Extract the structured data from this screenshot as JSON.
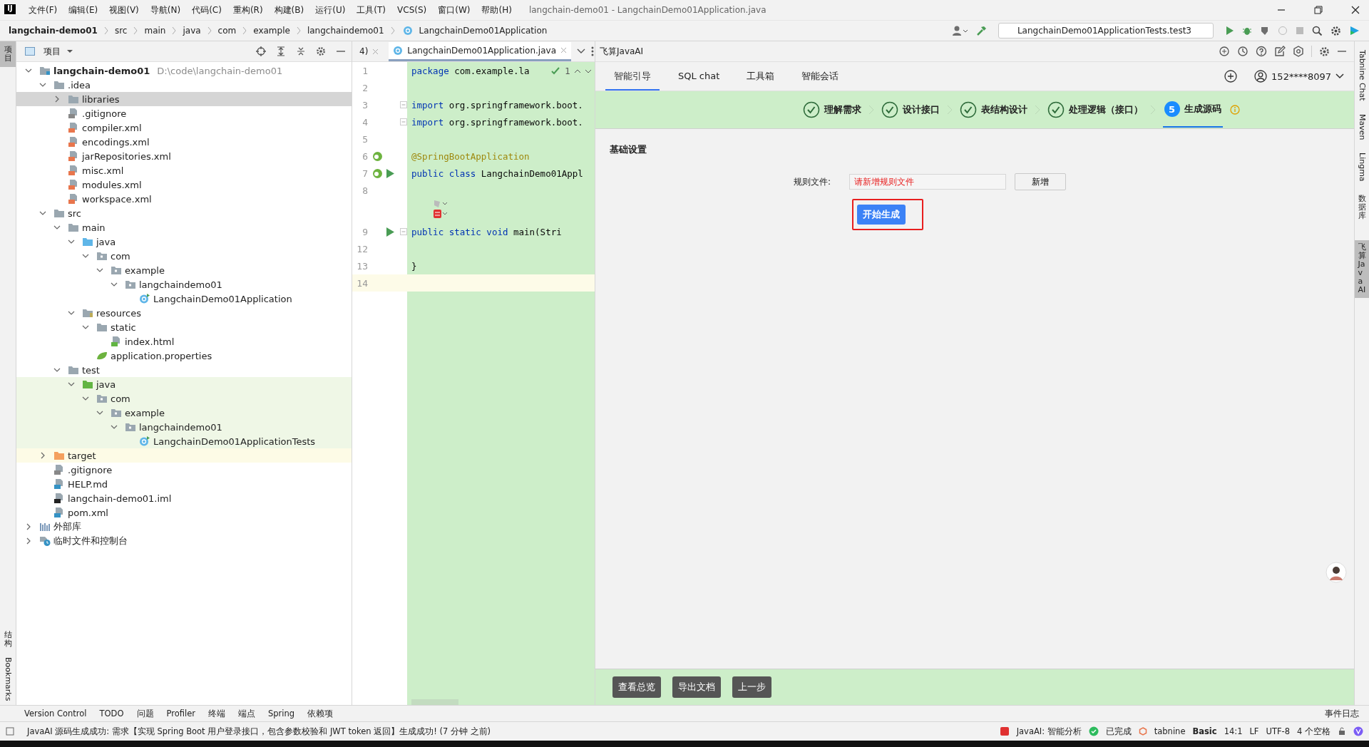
{
  "window": {
    "logo": "IJ",
    "title": "langchain-demo01 - LangchainDemo01Application.java"
  },
  "menu": [
    "文件(F)",
    "编辑(E)",
    "视图(V)",
    "导航(N)",
    "代码(C)",
    "重构(R)",
    "构建(B)",
    "运行(U)",
    "工具(T)",
    "VCS(S)",
    "窗口(W)",
    "帮助(H)"
  ],
  "breadcrumbs": [
    {
      "label": "langchain-demo01",
      "kind": "project"
    },
    {
      "label": "src",
      "kind": "dir"
    },
    {
      "label": "main",
      "kind": "dir"
    },
    {
      "label": "java",
      "kind": "dir"
    },
    {
      "label": "com",
      "kind": "dir"
    },
    {
      "label": "example",
      "kind": "dir"
    },
    {
      "label": "langchaindemo01",
      "kind": "dir"
    },
    {
      "label": "LangchainDemo01Application",
      "kind": "class"
    }
  ],
  "run_config": "LangchainDemo01ApplicationTests.test3",
  "left_strip": [
    {
      "label": "项目",
      "kind": "cjk",
      "selected": true
    },
    {
      "label": "结构",
      "kind": "cjk",
      "selected": false
    },
    {
      "label": "Bookmarks",
      "kind": "latin",
      "selected": false
    }
  ],
  "right_strip": [
    {
      "label": "Tabnine Chat",
      "kind": "latin",
      "selected": false
    },
    {
      "label": "Maven",
      "kind": "latin",
      "selected": false
    },
    {
      "label": "Lingma",
      "kind": "latin",
      "selected": false
    },
    {
      "label": "数据库",
      "kind": "cjk",
      "selected": false
    },
    {
      "label": "飞算JavaAI",
      "kind": "cjk",
      "selected": true
    }
  ],
  "project": {
    "title": "项目",
    "tree": [
      {
        "name": "langchain-demo01",
        "kind": "module",
        "path": "D:\\code\\langchain-demo01",
        "expanded": true,
        "selected": false,
        "children": [
          {
            "name": ".idea",
            "kind": "folder",
            "expanded": true,
            "selected": false,
            "children": [
              {
                "name": "libraries",
                "kind": "folder",
                "expanded": false,
                "selected": true
              },
              {
                "name": ".gitignore",
                "kind": "ignore",
                "selected": false
              },
              {
                "name": "compiler.xml",
                "kind": "xml",
                "selected": false
              },
              {
                "name": "encodings.xml",
                "kind": "xml",
                "selected": false
              },
              {
                "name": "jarRepositories.xml",
                "kind": "xml",
                "selected": false
              },
              {
                "name": "misc.xml",
                "kind": "xml",
                "selected": false
              },
              {
                "name": "modules.xml",
                "kind": "xml",
                "selected": false
              },
              {
                "name": "workspace.xml",
                "kind": "xml",
                "selected": false
              }
            ]
          },
          {
            "name": "src",
            "kind": "folder",
            "expanded": true,
            "selected": false,
            "children": [
              {
                "name": "main",
                "kind": "folder",
                "expanded": true,
                "selected": false,
                "children": [
                  {
                    "name": "java",
                    "kind": "source-folder",
                    "expanded": true,
                    "selected": false,
                    "children": [
                      {
                        "name": "com",
                        "kind": "package",
                        "expanded": true,
                        "selected": false,
                        "children": [
                          {
                            "name": "example",
                            "kind": "package",
                            "expanded": true,
                            "selected": false,
                            "children": [
                              {
                                "name": "langchaindemo01",
                                "kind": "package",
                                "expanded": true,
                                "selected": false,
                                "children": [
                                  {
                                    "name": "LangchainDemo01Application",
                                    "kind": "class",
                                    "selected": false
                                  }
                                ]
                              }
                            ]
                          }
                        ]
                      }
                    ]
                  },
                  {
                    "name": "resources",
                    "kind": "resources-folder",
                    "expanded": true,
                    "selected": false,
                    "children": [
                      {
                        "name": "static",
                        "kind": "folder",
                        "expanded": true,
                        "selected": false,
                        "children": [
                          {
                            "name": "index.html",
                            "kind": "html",
                            "selected": false
                          }
                        ]
                      },
                      {
                        "name": "application.properties",
                        "kind": "properties",
                        "selected": false
                      }
                    ]
                  }
                ]
              },
              {
                "name": "test",
                "kind": "folder",
                "expanded": true,
                "selected": false,
                "children": [
                  {
                    "name": "java",
                    "kind": "test-folder",
                    "test_root": true,
                    "expanded": true,
                    "selected": false,
                    "children": [
                      {
                        "name": "com",
                        "kind": "package",
                        "expanded": true,
                        "selected": false,
                        "children": [
                          {
                            "name": "example",
                            "kind": "package",
                            "expanded": true,
                            "selected": false,
                            "children": [
                              {
                                "name": "langchaindemo01",
                                "kind": "package",
                                "expanded": true,
                                "selected": false,
                                "children": [
                                  {
                                    "name": "LangchainDemo01ApplicationTests",
                                    "kind": "class",
                                    "selected": false
                                  }
                                ]
                              }
                            ]
                          }
                        ]
                      }
                    ]
                  }
                ]
              }
            ]
          },
          {
            "name": "target",
            "kind": "excluded-folder",
            "excluded": true,
            "expanded": false,
            "selected": false
          },
          {
            "name": ".gitignore",
            "kind": "ignore",
            "selected": false
          },
          {
            "name": "HELP.md",
            "kind": "md",
            "selected": false
          },
          {
            "name": "langchain-demo01.iml",
            "kind": "iml",
            "selected": false
          },
          {
            "name": "pom.xml",
            "kind": "pom",
            "selected": false
          }
        ]
      },
      {
        "name": "外部库",
        "kind": "libraries",
        "expanded": false,
        "selected": false
      },
      {
        "name": "临时文件和控制台",
        "kind": "scratches",
        "expanded": false,
        "selected": false
      }
    ]
  },
  "editor": {
    "tabs": [
      {
        "label": "4)",
        "selected": false
      },
      {
        "label": "LangchainDemo01Application.java",
        "selected": true
      }
    ],
    "inspection": {
      "count": "1"
    },
    "lines": [
      {
        "kind": "code",
        "number": "1",
        "current": false,
        "tokens": [
          {
            "kind": "keyword",
            "text": "package"
          },
          {
            "kind": "plain",
            "text": " com.example.la"
          }
        ]
      },
      {
        "kind": "code",
        "number": "2",
        "current": false
      },
      {
        "kind": "code",
        "number": "3",
        "current": false,
        "fold": true,
        "tokens": [
          {
            "kind": "keyword",
            "text": "import"
          },
          {
            "kind": "plain",
            "text": " org.springframework.boot."
          }
        ]
      },
      {
        "kind": "code",
        "number": "4",
        "current": false,
        "fold": true,
        "tokens": [
          {
            "kind": "keyword",
            "text": "import"
          },
          {
            "kind": "plain",
            "text": " org.springframework.boot."
          }
        ]
      },
      {
        "kind": "code",
        "number": "5",
        "current": false
      },
      {
        "kind": "code",
        "number": "6",
        "current": false,
        "bean": true,
        "tokens": [
          {
            "kind": "annotation",
            "text": "@SpringBootApplication"
          }
        ]
      },
      {
        "kind": "code",
        "number": "7",
        "current": false,
        "bean": true,
        "run": true,
        "tokens": [
          {
            "kind": "keyword",
            "text": "public class"
          },
          {
            "kind": "plain",
            "text": " LangchainDemo01Appl"
          }
        ]
      },
      {
        "kind": "code",
        "number": "8",
        "current": false
      },
      {
        "kind": "inlay"
      },
      {
        "kind": "code",
        "number": "9",
        "current": false,
        "run": true,
        "fold": true,
        "indented": true,
        "tokens": [
          {
            "kind": "keyword",
            "text": "public static void"
          },
          {
            "kind": "plain",
            "text": " main(Stri"
          }
        ]
      },
      {
        "kind": "code",
        "number": "12",
        "current": false
      },
      {
        "kind": "code",
        "number": "13",
        "current": false,
        "tokens": [
          {
            "kind": "plain",
            "text": "}"
          }
        ]
      },
      {
        "kind": "code",
        "number": "14",
        "current": true
      }
    ]
  },
  "ai_panel": {
    "title": "飞算JavaAI",
    "tabs": [
      {
        "label": "智能引导",
        "selected": true
      },
      {
        "label": "SQL chat",
        "selected": false
      },
      {
        "label": "工具箱",
        "selected": false
      },
      {
        "label": "智能会话",
        "selected": false
      }
    ],
    "account": "152****8097",
    "steps": [
      {
        "label": "理解需求",
        "done": true,
        "selected": false
      },
      {
        "label": "设计接口",
        "done": true,
        "selected": false
      },
      {
        "label": "表结构设计",
        "done": true,
        "selected": false
      },
      {
        "label": "处理逻辑（接口）",
        "done": true,
        "selected": false
      },
      {
        "label": "生成源码",
        "done": false,
        "selected": true,
        "number": "5"
      }
    ],
    "section": "基础设置",
    "field": {
      "label": "规则文件:",
      "placeholder": "请新增规则文件"
    },
    "add_button": "新增",
    "start_button": "开始生成",
    "footer_buttons": [
      "查看总览",
      "导出文档",
      "上一步"
    ]
  },
  "tool_windows": [
    "Version Control",
    "TODO",
    "问题",
    "Profiler",
    "终端",
    "端点",
    "Spring",
    "依赖项"
  ],
  "event_log": "事件日志",
  "status_bar": {
    "message": "JavaAI 源码生成成功: 需求【实现 Spring Boot 用户登录接口，包含参数校验和 JWT token 返回】生成成功! (7 分钟 之前)",
    "analysis": "JavaAI: 智能分析",
    "done": "已完成",
    "tabnine": "tabnine",
    "tabnine_plan": "Basic",
    "position": "14:1",
    "line_sep": "LF",
    "encoding": "UTF-8",
    "indent": "4 个空格"
  }
}
